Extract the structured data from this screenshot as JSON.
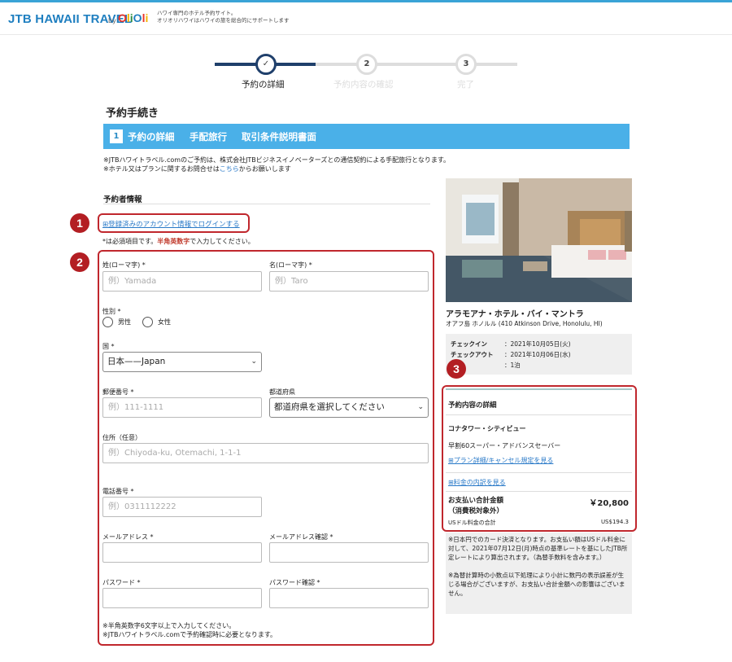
{
  "header": {
    "logo_main": "JTB HAWAII TRAVEL",
    "logo_by": "by",
    "logo_olioli": "OliOli",
    "tagline_1": "ハワイ専門のホテル予約サイト。",
    "tagline_2": "オリオリハワイはハワイの旅を総合的にサポートします"
  },
  "steps": [
    {
      "number": "✓",
      "label": "予約の詳細",
      "state": "active"
    },
    {
      "number": "2",
      "label": "予約内容の確認",
      "state": "inactive"
    },
    {
      "number": "3",
      "label": "完了",
      "state": "inactive"
    }
  ],
  "page_title": "予約手続き",
  "bluebar": {
    "number": "1",
    "items": [
      "予約の詳細",
      "手配旅行",
      "取引条件説明書面"
    ],
    "color": "#4ab0e8"
  },
  "notice": {
    "line1": "※JTBハワイトラベル.comのご予約は、株式会社JTBビジネスイノベーターズとの通信契約による手配旅行となります。",
    "line2_pre": "※ホテル又はプランに関するお問合せは",
    "line2_link": "こちら",
    "line2_post": "からお願いします"
  },
  "form": {
    "section_title": "予約者情報",
    "login_link": "⊞登録済みのアカウント情報でログインする",
    "required_note_pre": "*は必須項目です。",
    "required_note_bold": "半角英数字",
    "required_note_post": "で入力してください。",
    "last_name_label": "姓(ローマ字) *",
    "last_name_placeholder": "例）Yamada",
    "first_name_label": "名(ローマ字) *",
    "first_name_placeholder": "例）Taro",
    "gender_label": "性別 *",
    "gender_male": "男性",
    "gender_female": "女性",
    "country_label": "国 *",
    "country_value": "日本——Japan",
    "postal_label": "郵便番号 *",
    "postal_placeholder": "例）111-1111",
    "prefecture_label": "都道府県",
    "prefecture_value": "都道府県を選択してください",
    "address_label": "住所（任意）",
    "address_placeholder": "例）Chiyoda-ku, Otemachi, 1-1-1",
    "phone_label": "電話番号 *",
    "phone_placeholder": "例）0311112222",
    "email_label": "メールアドレス *",
    "email_confirm_label": "メールアドレス確認 *",
    "password_label": "パスワード *",
    "password_confirm_label": "パスワード確認 *",
    "password_note_1": "※半角英数字6文字以上で入力してください。",
    "password_note_2": "※JTBハワイトラベル.comで予約確認時に必要となります。"
  },
  "badges": [
    "1",
    "2",
    "3"
  ],
  "hotel": {
    "name": "アラモアナ・ホテル・バイ・マントラ",
    "address": "オアフ島 ホノルル (410 Atkinson Drive, Honolulu, HI)",
    "checkin_label": "チェックイン",
    "checkin_value": "：2021年10月05日(火)",
    "checkout_label": "チェックアウト",
    "checkout_value": "：2021年10月06日(水)",
    "nights_label": "泊数",
    "nights_value": "：1泊"
  },
  "details": {
    "title": "予約内容の詳細",
    "room": "コナタワー・シティビュー",
    "plan": "早割60スーパー・アドバンスセーバー",
    "plan_link": "⊞プラン詳細/キャンセル規定を見る",
    "breakdown_link": "⊞料金の内訳を見る",
    "total_label_1": "お支払い合計金額",
    "total_label_2": "（消費税対象外）",
    "total_amount": "￥20,800",
    "usd_label": "USドル料金の合計",
    "usd_amount": "US$194.3"
  },
  "payment_note": {
    "p1": "※日本円でのカード決済となります。お支払い額はUSドル料金に対して、2021年07月12日(月)時点の基準レートを基にしたJTB所定レートにより算出されます。（為替手数料を含みます。）",
    "p2": "※為替計算時の小数点以下処理により小計に数円の表示誤差が生じる場合がございますが、お支払い合計金額への影響はございません。"
  },
  "colors": {
    "accent": "#4ab0e8",
    "logo": "#1f7fc0",
    "highlight_red": "#c0272d",
    "step_active": "#1f3f6b"
  }
}
